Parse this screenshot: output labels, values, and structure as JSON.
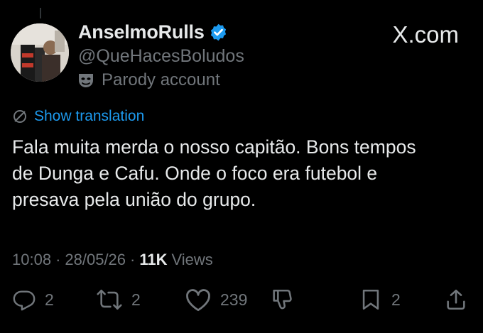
{
  "author": {
    "display_name": "AnselmoRulls",
    "handle": "@QueHacesBoludos",
    "label": "Parody account",
    "verified": true
  },
  "watermark": "X.com",
  "translate_label": "Show translation",
  "tweet_text": "Fala muita merda o nosso capitão.  Bons tempos\nde Dunga e Cafu. Onde o foco era futebol e\npresava pela união do grupo.",
  "meta": {
    "time": "10:08",
    "date": "28/05/26",
    "views_count": "11K",
    "views_label": "Views"
  },
  "actions": {
    "replies": "2",
    "reposts": "2",
    "likes": "239",
    "bookmarks": "2"
  },
  "colors": {
    "background": "#000000",
    "text": "#e7e9ea",
    "muted": "#71767b",
    "accent": "#1d9bf0"
  },
  "icons": [
    "verified-badge-icon",
    "mask-icon",
    "x-logo-icon",
    "translate-icon",
    "reply-icon",
    "repost-icon",
    "like-icon",
    "dislike-icon",
    "bookmark-icon",
    "share-icon"
  ]
}
